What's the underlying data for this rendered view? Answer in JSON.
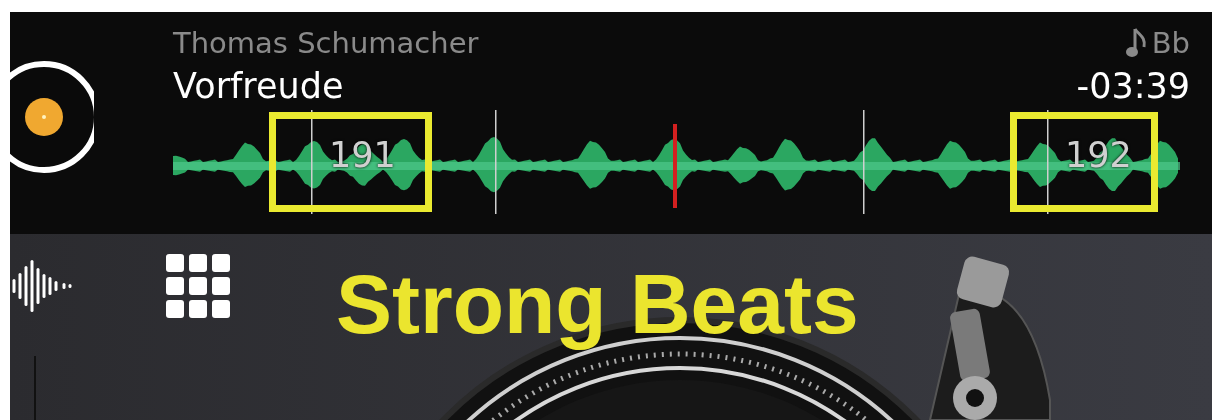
{
  "deck": {
    "artist": "Thomas Schumacher",
    "title": "Vorfreude",
    "key": "Bb",
    "remaining": "-03:39",
    "beat_markers": [
      {
        "label": "191",
        "highlighted": true
      },
      {
        "label": "192",
        "highlighted": true
      }
    ]
  },
  "annotation": {
    "caption": "Strong Beats"
  }
}
